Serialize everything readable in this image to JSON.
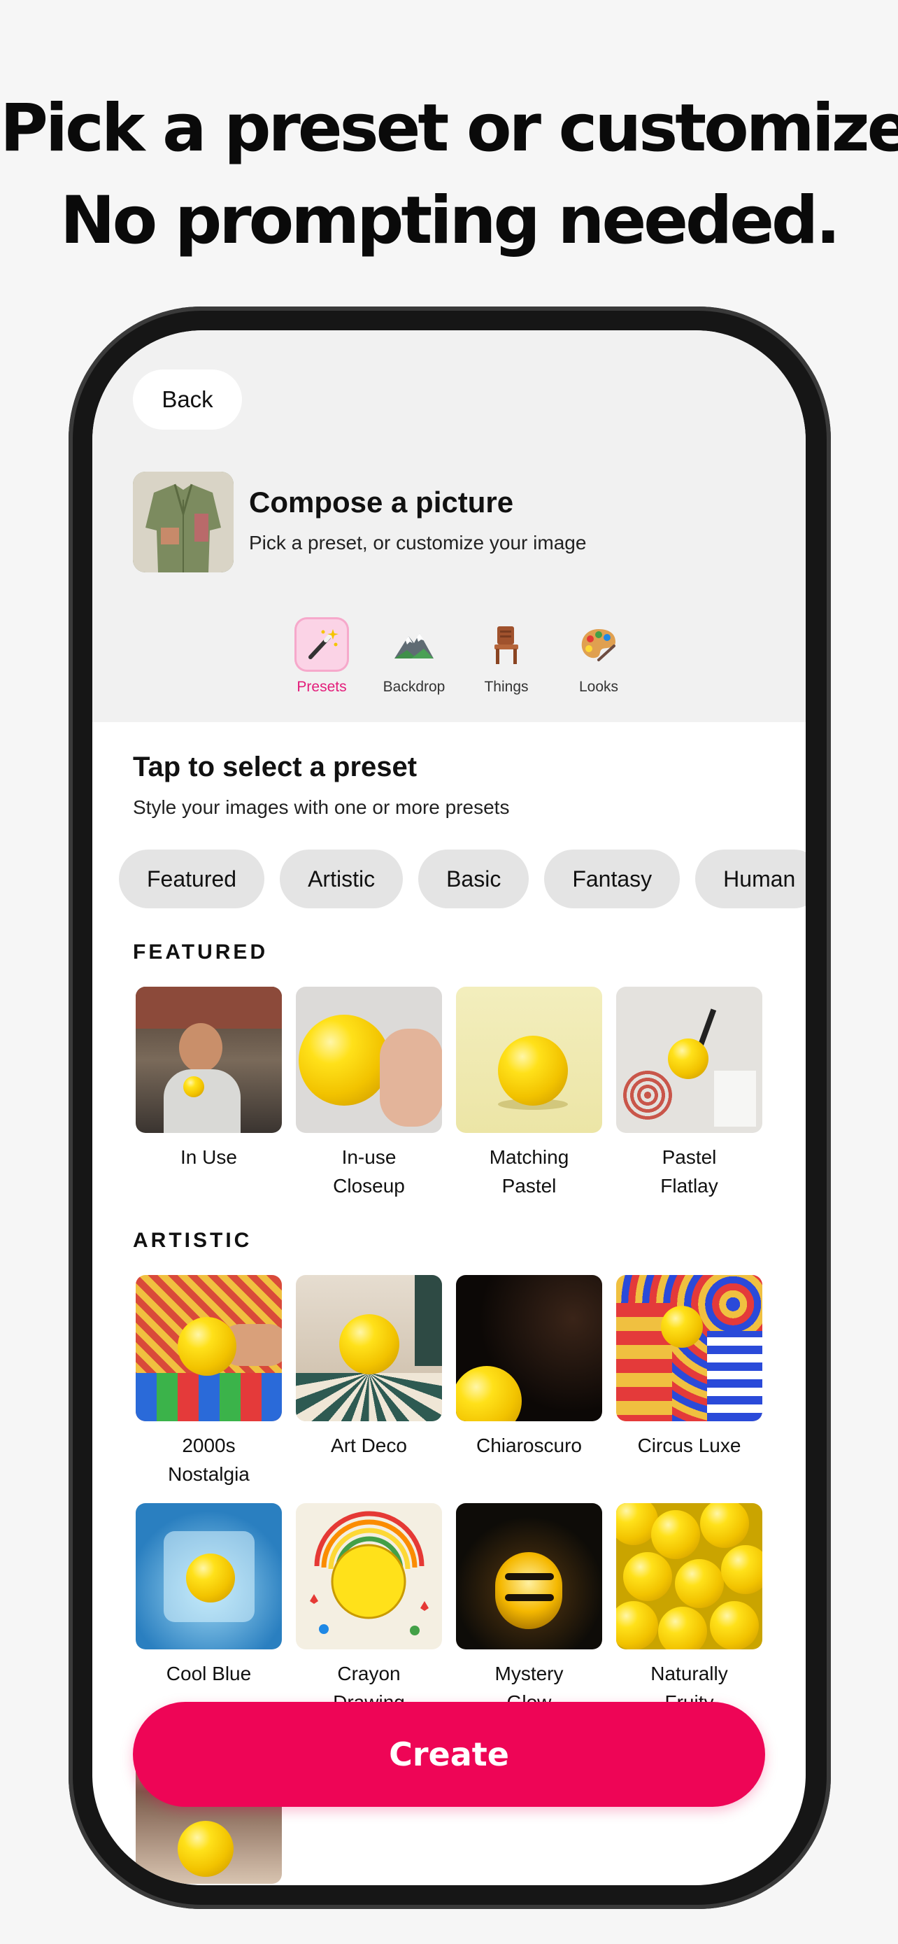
{
  "headline": {
    "line1": "Pick a preset or customize.",
    "line2": "No prompting needed."
  },
  "header": {
    "back_label": "Back",
    "title": "Compose a picture",
    "subtitle": "Pick a preset, or customize your image"
  },
  "tabs": [
    {
      "label": "Presets",
      "icon": "magic-wand-icon",
      "active": true
    },
    {
      "label": "Backdrop",
      "icon": "mountain-icon",
      "active": false
    },
    {
      "label": "Things",
      "icon": "chair-icon",
      "active": false
    },
    {
      "label": "Looks",
      "icon": "palette-icon",
      "active": false
    }
  ],
  "section": {
    "title": "Tap to select a preset",
    "subtitle": "Style your images with one or more presets"
  },
  "chips": [
    "Featured",
    "Artistic",
    "Basic",
    "Fantasy",
    "Human"
  ],
  "groups": {
    "featured": {
      "label": "FEATURED",
      "items": [
        {
          "line1": "In Use",
          "line2": ""
        },
        {
          "line1": "In-use",
          "line2": "Closeup"
        },
        {
          "line1": "Matching",
          "line2": "Pastel"
        },
        {
          "line1": "Pastel",
          "line2": "Flatlay"
        }
      ]
    },
    "artistic": {
      "label": "ARTISTIC",
      "items": [
        {
          "line1": "2000s",
          "line2": "Nostalgia"
        },
        {
          "line1": "Art Deco",
          "line2": ""
        },
        {
          "line1": "Chiaroscuro",
          "line2": ""
        },
        {
          "line1": "Circus Luxe",
          "line2": ""
        },
        {
          "line1": "Cool Blue",
          "line2": ""
        },
        {
          "line1": "Crayon",
          "line2": "Drawing"
        },
        {
          "line1": "Mystery",
          "line2": "Glow"
        },
        {
          "line1": "Naturally",
          "line2": "Fruity"
        }
      ]
    }
  },
  "create_label": "Create",
  "colors": {
    "accent": "#ee0556",
    "active_tab": "#e31d7a"
  }
}
